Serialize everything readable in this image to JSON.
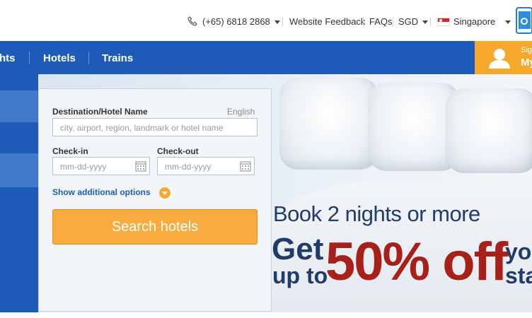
{
  "topbar": {
    "phone": "(+65) 6818 2868",
    "feedback": "Website Feedback",
    "faqs": "FAQs",
    "currency": "SGD",
    "country": "Singapore"
  },
  "nav": {
    "items": [
      "hts",
      "Hotels",
      "Trains"
    ],
    "signin_small": "Sig",
    "signin_big": "My"
  },
  "form": {
    "destination_label": "Destination/Hotel Name",
    "language": "English",
    "destination_placeholder": "city, airport, region, landmark or hotel name",
    "checkin_label": "Check-in",
    "checkout_label": "Check-out",
    "date_placeholder": "mm-dd-yyyy",
    "additional_options": "Show additional options",
    "search_button": "Search hotels"
  },
  "promo": {
    "line1": "Book 2 nights or more",
    "get": "Get",
    "up_to": "up to",
    "percent": "50% off",
    "your": "you",
    "stay": "sta"
  },
  "colors": {
    "brand_blue": "#1e5bb8",
    "accent_orange": "#f6a82b",
    "promo_red": "#a8201a",
    "promo_navy": "#1f3c6b"
  },
  "icons": [
    "phone-icon",
    "caret-down-icon",
    "singapore-flag-icon",
    "mobile-app-icon",
    "user-avatar-icon",
    "calendar-icon"
  ]
}
